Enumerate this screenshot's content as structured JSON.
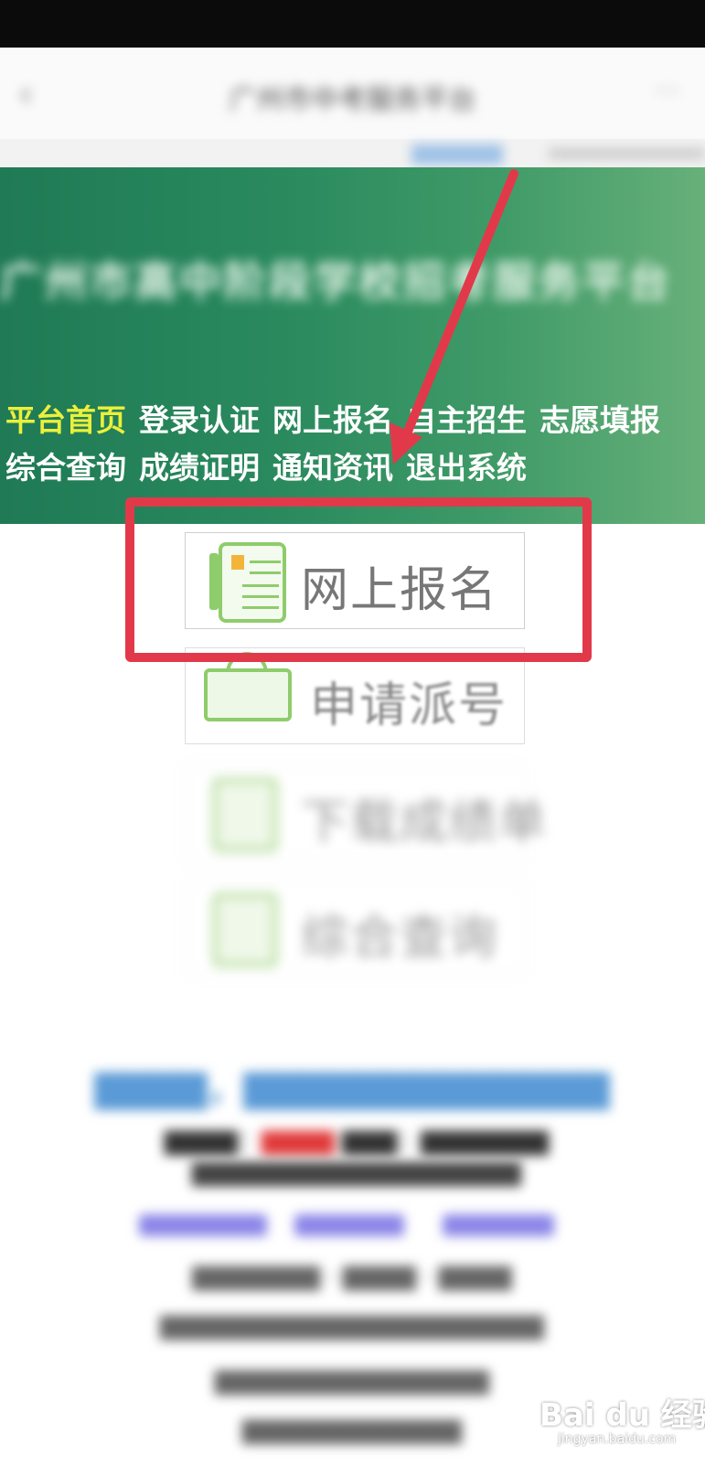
{
  "header": {
    "title": "广州市中考服务平台"
  },
  "banner": {
    "title": "广州市高中阶段学校招考服务平台"
  },
  "nav": {
    "row1": [
      "平台首页",
      "登录认证",
      "网上报名",
      "自主招生",
      "志愿填报"
    ],
    "row2": [
      "综合查询",
      "成绩证明",
      "通知资讯",
      "退出系统"
    ],
    "active": "平台首页",
    "active_color": "#ecf03a"
  },
  "menu": {
    "items": [
      {
        "label": "网上报名",
        "icon": "register-form-icon"
      },
      {
        "label": "申请派号",
        "icon": "shop-sign-icon"
      },
      {
        "label": "下载成绩单",
        "icon": "download-report-icon"
      },
      {
        "label": "综合查询",
        "icon": "query-icon"
      }
    ]
  },
  "annotation": {
    "highlight_color": "#e2394a"
  },
  "watermark": {
    "brand": "Bai du 经验",
    "url": "jingyan.baidu.com"
  }
}
